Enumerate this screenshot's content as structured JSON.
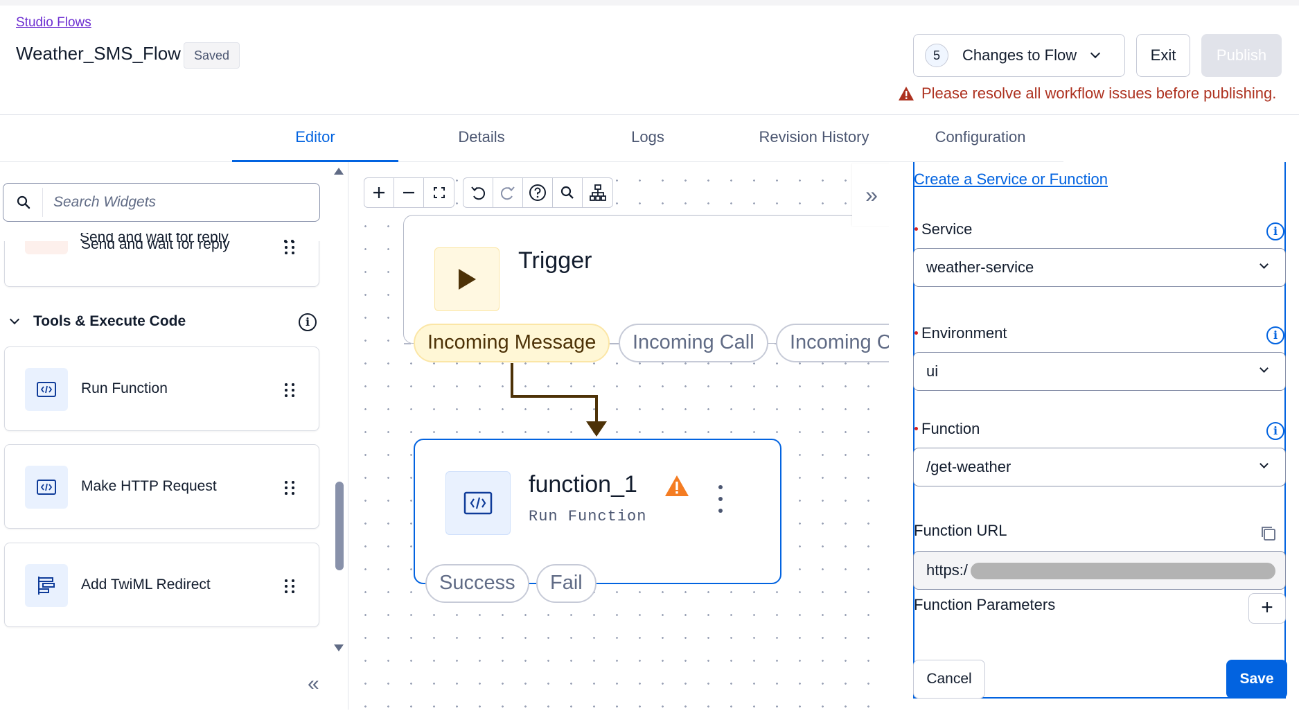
{
  "header": {
    "breadcrumb": "Studio Flows",
    "flow_name": "Weather_SMS_Flow",
    "saved_badge": "Saved",
    "changes_count": "5",
    "changes_label": "Changes to Flow",
    "exit_label": "Exit",
    "publish_label": "Publish",
    "warning_text": "Please resolve all workflow issues before publishing."
  },
  "tabs": [
    {
      "label": "Editor",
      "active": true
    },
    {
      "label": "Details",
      "active": false
    },
    {
      "label": "Logs",
      "active": false
    },
    {
      "label": "Revision History",
      "active": false
    },
    {
      "label": "Configuration",
      "active": false
    }
  ],
  "sidebar": {
    "search_placeholder": "Search Widgets",
    "partial_widget": "Send and wait for reply",
    "section_title": "Tools & Execute Code",
    "widgets": [
      {
        "label": "Run Function",
        "icon": "code-icon"
      },
      {
        "label": "Make HTTP Request",
        "icon": "code-icon"
      },
      {
        "label": "Add TwiML Redirect",
        "icon": "redirect-icon"
      }
    ]
  },
  "canvas": {
    "trigger": {
      "title": "Trigger",
      "transitions": [
        "Incoming Message",
        "Incoming Call",
        "Incoming C"
      ]
    },
    "function_node": {
      "title": "function_1",
      "subtitle": "Run Function",
      "transitions": [
        "Success",
        "Fail"
      ]
    }
  },
  "config_panel": {
    "create_link": "Create a Service or Function",
    "service_label": "Service",
    "service_value": "weather-service",
    "environment_label": "Environment",
    "environment_value": "ui",
    "function_label": "Function",
    "function_value": "/get-weather",
    "function_url_label": "Function URL",
    "function_url_value": "https:/",
    "function_params_label": "Function Parameters",
    "cancel_label": "Cancel",
    "save_label": "Save"
  },
  "colors": {
    "accent": "#0263e0",
    "warning": "#ad311f",
    "warning_icon": "#f47c22",
    "breadcrumb": "#6d2ed1"
  }
}
